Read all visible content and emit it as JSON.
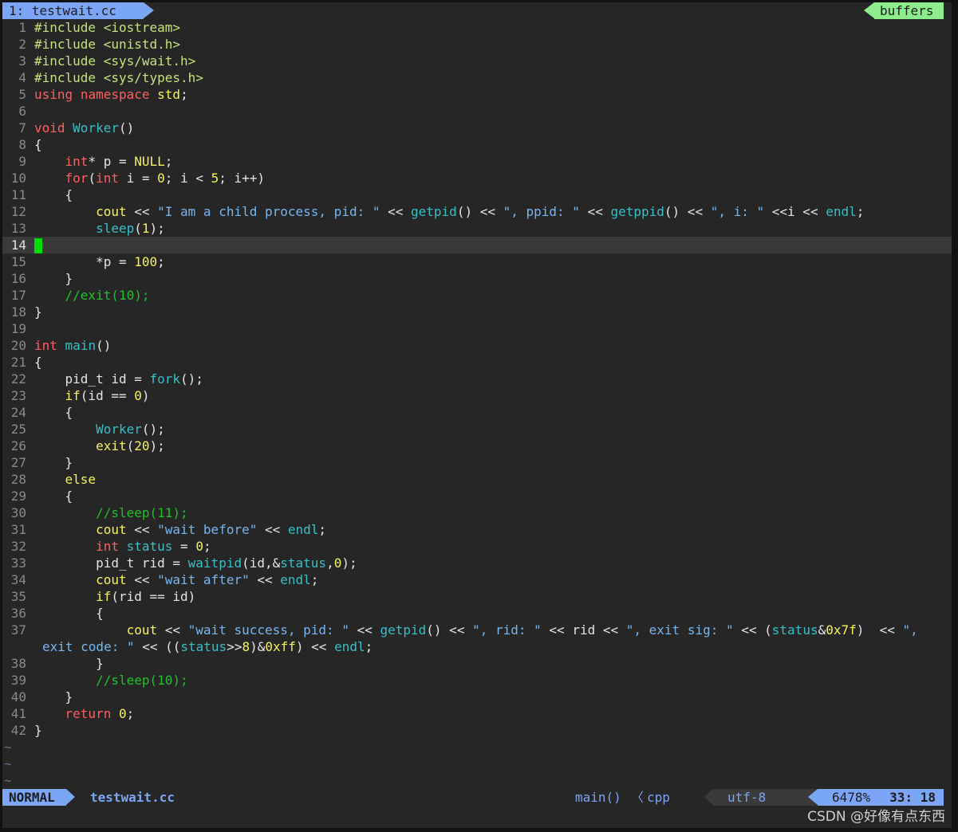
{
  "tabline": {
    "tab_label": "1: testwait.cc",
    "buffers_label": "buffers"
  },
  "editor": {
    "tilde": "~",
    "cursor_line": 14
  },
  "status": {
    "mode": "NORMAL",
    "filename": "testwait.cc",
    "func": "main()",
    "separator": "〈",
    "filetype": "cpp",
    "encoding": "utf-8",
    "percent": "6478%",
    "position": "33: 18"
  },
  "watermark": "CSDN @好像有点东西",
  "colors": {
    "accent": "#7aa6f5",
    "buffers": "#8bee8b",
    "cursor": "#00e000",
    "keyword": "#ff5f5f",
    "preprocessor": "#c4e37b",
    "function": "#36c0c8",
    "number": "#f6f35e",
    "string": "#78b6f2",
    "comment": "#22c02a"
  }
}
